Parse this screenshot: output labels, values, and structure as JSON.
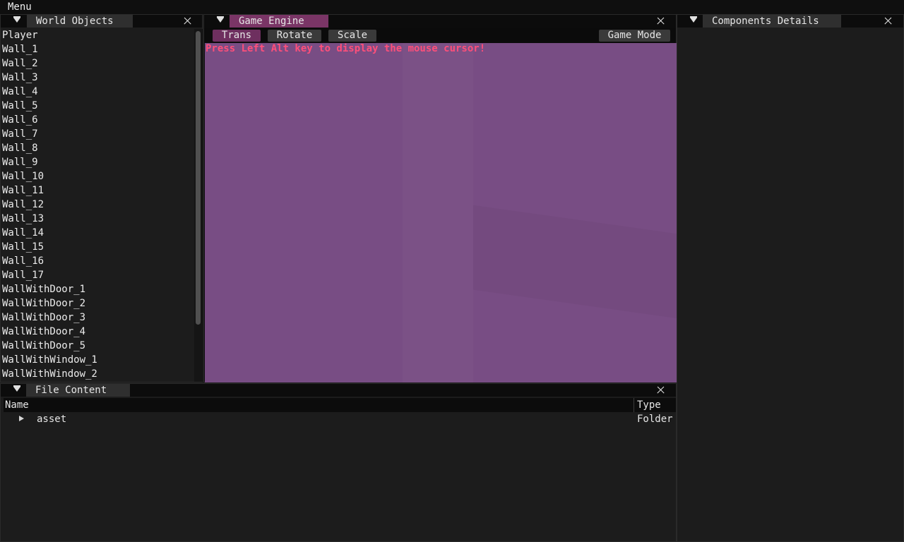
{
  "menubar": {
    "menu_label": "Menu"
  },
  "world_objects": {
    "title": "World Objects",
    "items": [
      "Player",
      "Wall_1",
      "Wall_2",
      "Wall_3",
      "Wall_4",
      "Wall_5",
      "Wall_6",
      "Wall_7",
      "Wall_8",
      "Wall_9",
      "Wall_10",
      "Wall_11",
      "Wall_12",
      "Wall_13",
      "Wall_14",
      "Wall_15",
      "Wall_16",
      "Wall_17",
      "WallWithDoor_1",
      "WallWithDoor_2",
      "WallWithDoor_3",
      "WallWithDoor_4",
      "WallWithDoor_5",
      "WallWithWindow_1",
      "WallWithWindow_2"
    ]
  },
  "game_engine": {
    "title": "Game Engine",
    "toolbar": {
      "trans": "Trans",
      "rotate": "Rotate",
      "scale": "Scale",
      "game_mode": "Game Mode"
    },
    "message": "Press Left Alt key to display the mouse cursor!"
  },
  "components": {
    "title": "Components Details"
  },
  "file_content": {
    "title": "File Content",
    "columns": {
      "name": "Name",
      "type": "Type"
    },
    "rows": [
      {
        "name": "asset",
        "type": "Folder"
      }
    ]
  },
  "colors": {
    "active_tab": "#7a3566",
    "inactive_tab": "#2f2f2f",
    "active_button": "#6e2f5f",
    "viewport": "#784d84",
    "message": "#ff4f7a"
  },
  "icons": {
    "panel_menu": "triangle-down-icon",
    "close": "close-icon",
    "expand": "caret-right-icon"
  }
}
